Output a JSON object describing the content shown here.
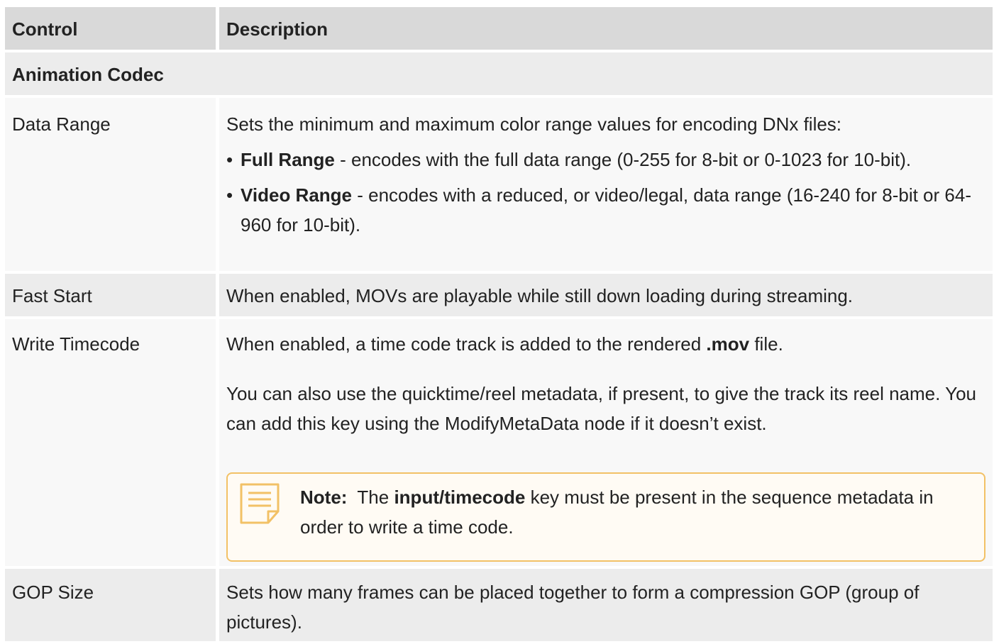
{
  "header": {
    "col1": "Control",
    "col2": "Description"
  },
  "section": {
    "title": "Animation Codec"
  },
  "rows": [
    {
      "control": "Data Range",
      "intro": "Sets the minimum and maximum color range values for encoding DNx files:",
      "bullets": [
        {
          "label": "Full Range",
          "text": " - encodes with the full data range (0-255 for 8-bit or 0-1023 for 10-bit)."
        },
        {
          "label": "Video Range",
          "text": " - encodes with a reduced, or video/legal, data range (16-240 for 8-bit or 64-960 for 10-bit)."
        }
      ]
    },
    {
      "control": "Fast Start",
      "text": "When enabled, MOVs are playable while still down loading during streaming."
    },
    {
      "control": "Write Timecode",
      "p1_a": "When enabled, a time code track is added to the rendered ",
      "p1_b": ".mov",
      "p1_c": " file.",
      "p2": "You can also use the quicktime/reel metadata, if present, to give the track its reel name. You can add this key using the ModifyMetaData node if it doesn’t exist.",
      "note": {
        "label": "Note:",
        "a": "The ",
        "b": "input/timecode",
        "c": " key must be present in the sequence metadata in order to write a time code."
      }
    },
    {
      "control": "GOP Size",
      "text": "Sets how many frames can be placed together to form a compression GOP (group of pictures)."
    }
  ],
  "colors": {
    "header_bg": "#d9d9d9",
    "section_bg": "#ececec",
    "row_bg": "#f8f8f8",
    "note_border": "#f2c166",
    "note_icon": "#f2c166"
  },
  "icons": {
    "note": "note-document-icon"
  }
}
